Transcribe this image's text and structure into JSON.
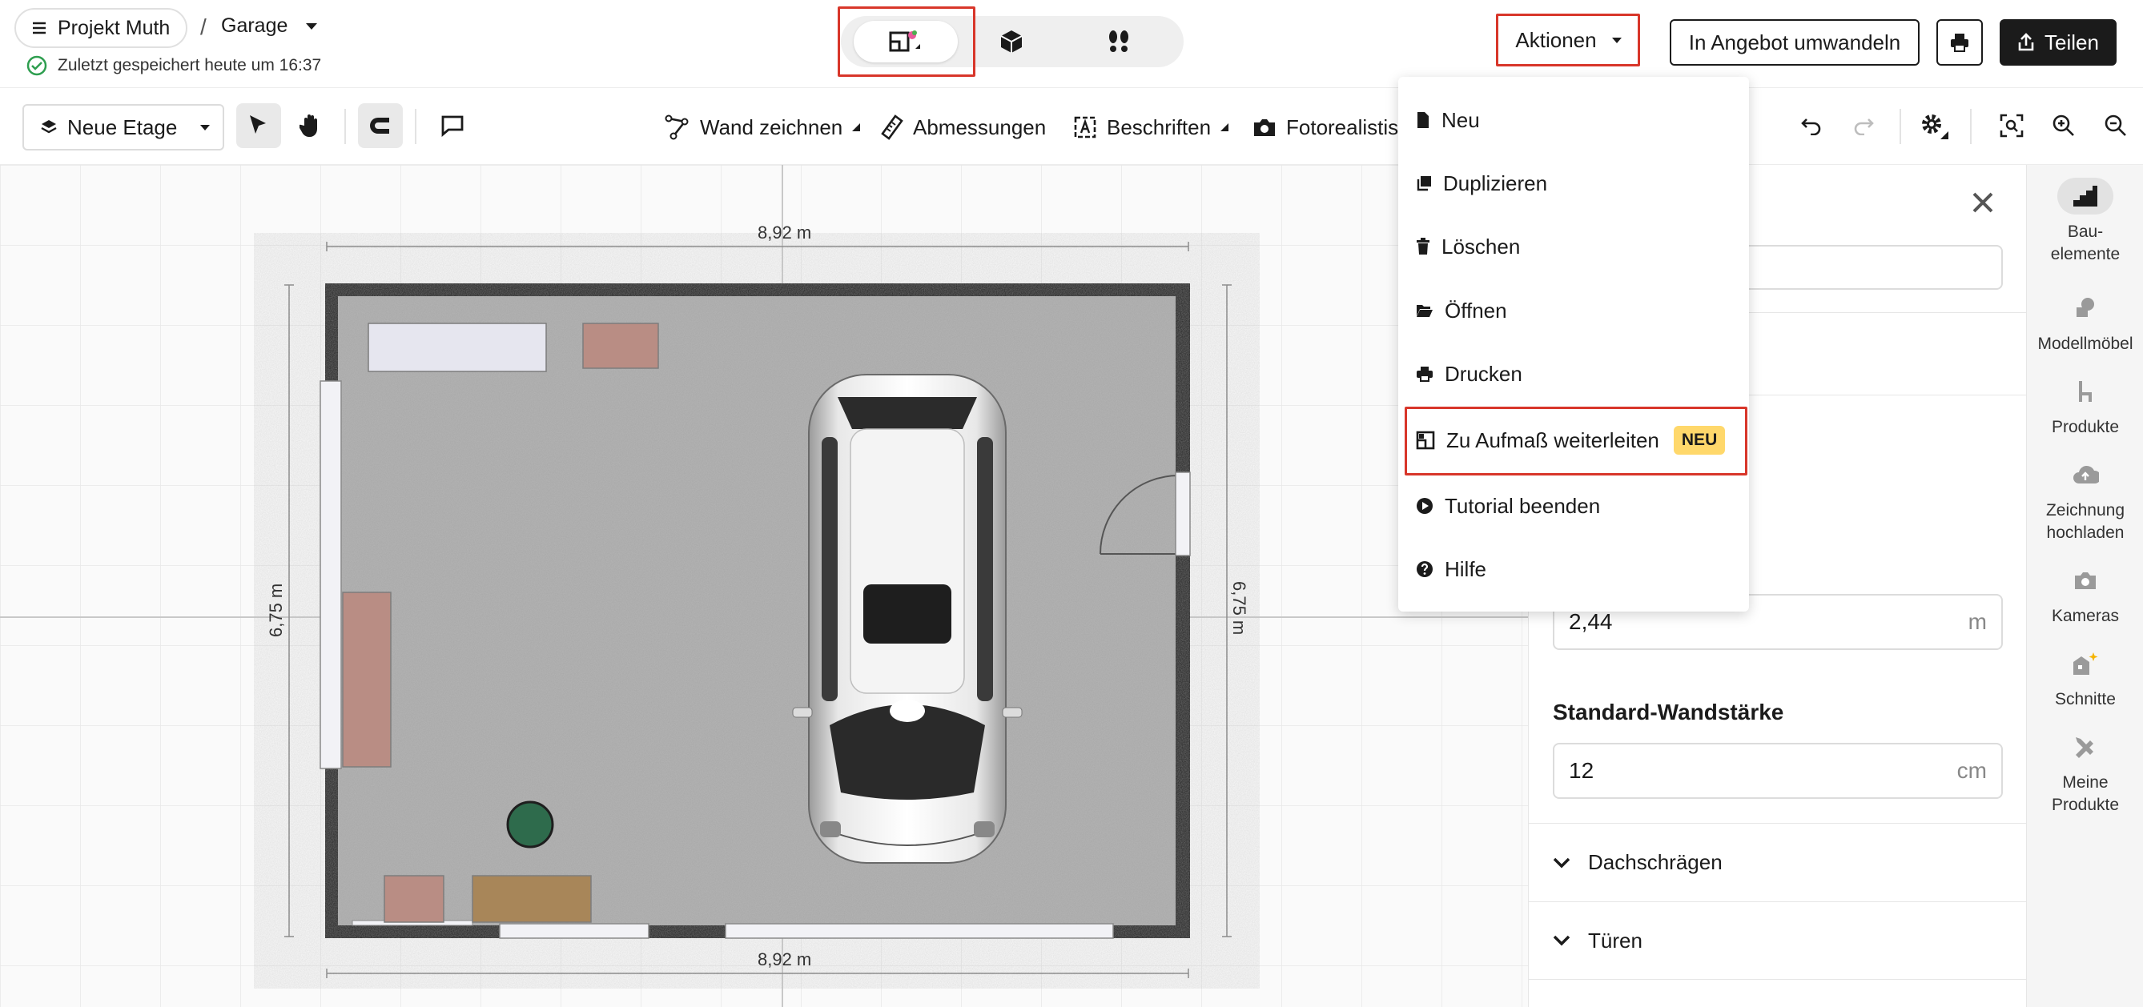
{
  "header": {
    "project_name": "Projekt Muth",
    "separator": "/",
    "room_name": "Garage",
    "saved_status": "Zuletzt gespeichert heute um 16:37",
    "actions_label": "Aktionen",
    "convert_label": "In Angebot umwandeln",
    "share_label": "Teilen"
  },
  "toolbar": {
    "floor_label": "Neue Etage",
    "draw_wall": "Wand zeichnen",
    "dimensions": "Abmessungen",
    "labels": "Beschriften",
    "photorealistic": "Fotorealistis"
  },
  "plan": {
    "width_top": "8,92 m",
    "width_bottom": "8,92 m",
    "height_left": "6,75 m",
    "height_right": "6,75 m"
  },
  "menu": {
    "items": [
      {
        "label": "Neu"
      },
      {
        "label": "Duplizieren"
      },
      {
        "label": "Löschen"
      },
      {
        "label": "Öffnen"
      },
      {
        "label": "Drucken"
      },
      {
        "label": "Zu Aufmaß weiterleiten",
        "badge": "NEU"
      },
      {
        "label": "Tutorial beenden"
      },
      {
        "label": "Hilfe"
      }
    ]
  },
  "panel": {
    "height_value": "2,44",
    "height_unit": "m",
    "wall_thickness_title": "Standard-Wandstärke",
    "wall_thickness_value": "12",
    "wall_thickness_unit": "cm",
    "section_roof": "Dachschrägen",
    "section_doors": "Türen"
  },
  "sidebar": {
    "items": [
      {
        "label": "Bau-\nelemente"
      },
      {
        "label": "Modellmöbel"
      },
      {
        "label": "Produkte"
      },
      {
        "label": "Zeichnung hochladen"
      },
      {
        "label": "Kameras"
      },
      {
        "label": "Schnitte"
      },
      {
        "label": "Meine Produkte"
      }
    ]
  },
  "colors": {
    "accent_red": "#d8362a",
    "badge_yellow": "#ffd86b",
    "dark_button": "#1b1b1b",
    "saved_green": "#2e9e4f"
  }
}
